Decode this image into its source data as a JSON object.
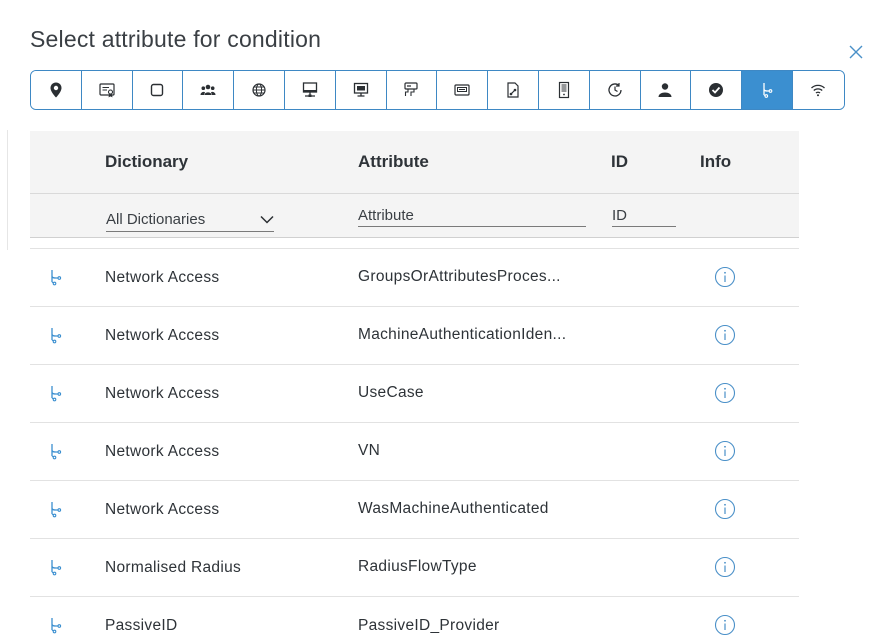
{
  "dialog": {
    "title": "Select attribute for condition"
  },
  "toolbar": {
    "buttons": [
      {
        "name": "location-pin-icon",
        "active": false
      },
      {
        "name": "id-card-icon",
        "active": false
      },
      {
        "name": "square-icon",
        "active": false
      },
      {
        "name": "user-group-icon",
        "active": false
      },
      {
        "name": "globe-icon",
        "active": false
      },
      {
        "name": "computer-network-icon",
        "active": false
      },
      {
        "name": "monitor-icon",
        "active": false
      },
      {
        "name": "network-device-icon",
        "active": false
      },
      {
        "name": "router-icon",
        "active": false
      },
      {
        "name": "certificate-file-icon",
        "active": false
      },
      {
        "name": "server-icon",
        "active": false
      },
      {
        "name": "clock-icon",
        "active": false
      },
      {
        "name": "user-icon",
        "active": false
      },
      {
        "name": "check-circle-icon",
        "active": false
      },
      {
        "name": "network-access-icon",
        "active": true
      },
      {
        "name": "wifi-icon",
        "active": false
      }
    ],
    "accent_color": "#3b8fd0"
  },
  "table": {
    "headers": {
      "dictionary": "Dictionary",
      "attribute": "Attribute",
      "id": "ID",
      "info": "Info"
    },
    "filters": {
      "dictionary_selected": "All Dictionaries",
      "attribute_placeholder": "Attribute",
      "id_placeholder": "ID"
    },
    "rows": [
      {
        "dictionary": "Network Access",
        "attribute": "GroupsOrAttributesProces...",
        "id": ""
      },
      {
        "dictionary": "Network Access",
        "attribute": "MachineAuthenticationIden...",
        "id": ""
      },
      {
        "dictionary": "Network Access",
        "attribute": "UseCase",
        "id": ""
      },
      {
        "dictionary": "Network Access",
        "attribute": "VN",
        "id": ""
      },
      {
        "dictionary": "Network Access",
        "attribute": "WasMachineAuthenticated",
        "id": ""
      },
      {
        "dictionary": "Normalised Radius",
        "attribute": "RadiusFlowType",
        "id": ""
      },
      {
        "dictionary": "PassiveID",
        "attribute": "PassiveID_Provider",
        "id": ""
      }
    ]
  }
}
